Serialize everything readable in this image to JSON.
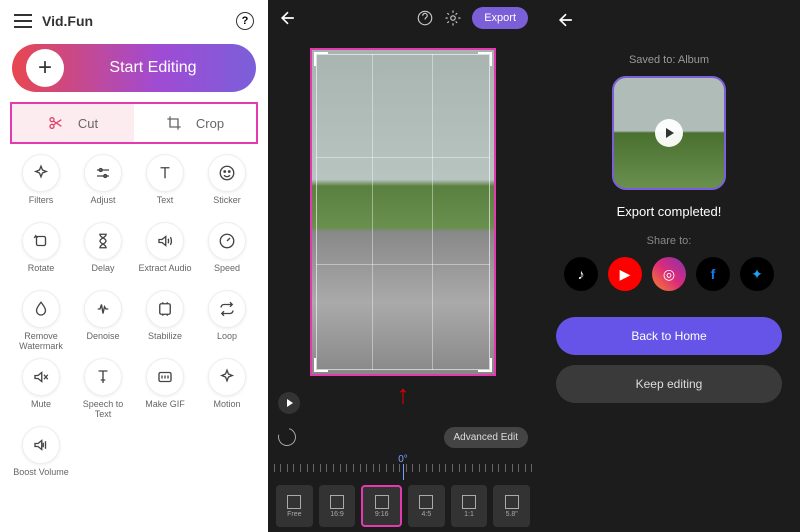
{
  "panel1": {
    "brand": "Vid.Fun",
    "start": "Start Editing",
    "tabs": [
      {
        "label": "Cut",
        "name": "cut"
      },
      {
        "label": "Crop",
        "name": "crop"
      }
    ],
    "tools": [
      {
        "label": "Filters",
        "icon": "sparkle"
      },
      {
        "label": "Adjust",
        "icon": "sliders"
      },
      {
        "label": "Text",
        "icon": "text"
      },
      {
        "label": "Sticker",
        "icon": "smile"
      },
      {
        "label": "Rotate",
        "icon": "rotate"
      },
      {
        "label": "Delay",
        "icon": "hourglass"
      },
      {
        "label": "Extract Audio",
        "icon": "audio"
      },
      {
        "label": "Speed",
        "icon": "speed"
      },
      {
        "label": "Remove Watermark",
        "icon": "drop"
      },
      {
        "label": "Denoise",
        "icon": "denoise"
      },
      {
        "label": "Stabilize",
        "icon": "stabilize"
      },
      {
        "label": "Loop",
        "icon": "loop"
      },
      {
        "label": "Mute",
        "icon": "mute"
      },
      {
        "label": "Speech to Text",
        "icon": "speech"
      },
      {
        "label": "Make GIF",
        "icon": "gif"
      },
      {
        "label": "Motion",
        "icon": "motion"
      },
      {
        "label": "Boost Volume",
        "icon": "boost"
      }
    ]
  },
  "panel2": {
    "export": "Export",
    "advanced": "Advanced Edit",
    "ruler_zero": "0°",
    "formats": [
      {
        "label": "Free",
        "ratio": ""
      },
      {
        "label": "16:9",
        "ratio": "16:9"
      },
      {
        "label": "9:16",
        "ratio": "9:16",
        "selected": true
      },
      {
        "label": "4:5",
        "ratio": "4:5"
      },
      {
        "label": "1:1",
        "ratio": "1:1"
      },
      {
        "label": "5.8\"",
        "ratio": ""
      }
    ]
  },
  "panel3": {
    "saved_to": "Saved to: Album",
    "completed": "Export completed!",
    "share": "Share to:",
    "back_home": "Back to Home",
    "keep": "Keep editing"
  }
}
